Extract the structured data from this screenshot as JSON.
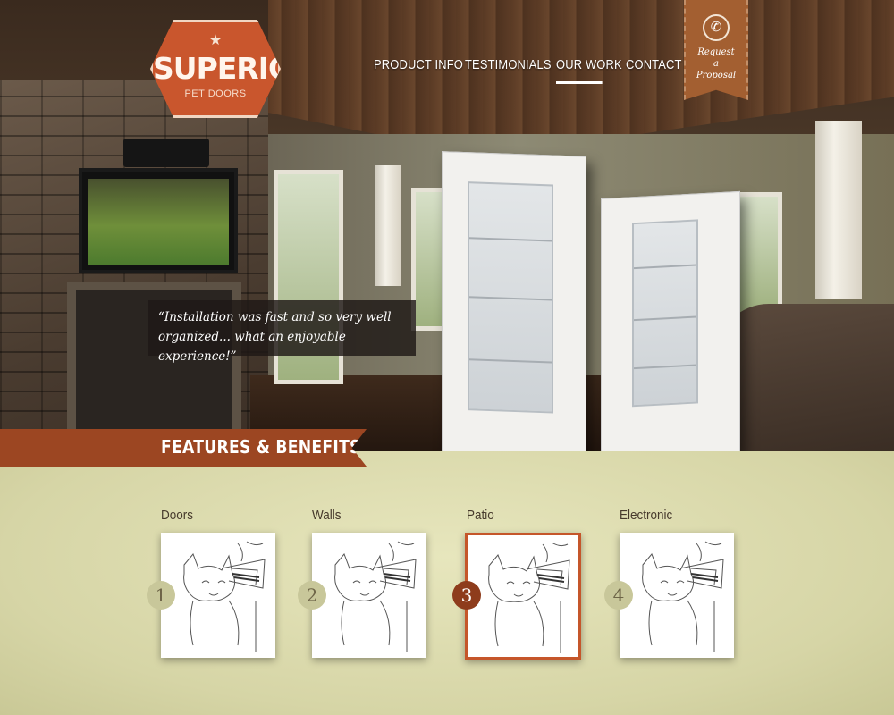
{
  "logo": {
    "brand": "SUPERIOR",
    "tagline": "PET DOORS"
  },
  "nav": [
    {
      "label": "PRODUCT INFO",
      "active": false
    },
    {
      "label": "TESTIMONIALS",
      "active": false
    },
    {
      "label": "OUR WORK",
      "active": true
    },
    {
      "label": "CONTACT",
      "active": false
    }
  ],
  "request": {
    "line1": "Request",
    "line2": "a",
    "line3": "Proposal"
  },
  "testimonial": {
    "line1": "“Installation was fast and so very well",
    "line2": "organized... what an enjoyable experience!”"
  },
  "features": {
    "heading": "FEATURES & BENEFITS"
  },
  "categories": [
    {
      "title": "Doors",
      "number": "1",
      "active": false
    },
    {
      "title": "Walls",
      "number": "2",
      "active": false
    },
    {
      "title": "Patio",
      "number": "3",
      "active": true
    },
    {
      "title": "Electronic",
      "number": "4",
      "active": false
    }
  ],
  "colors": {
    "accent": "#c9562d",
    "banner": "#a35f31",
    "ribbon": "#9c4622",
    "background": "#dcdcaa"
  },
  "icons": {
    "phone": "phone-icon",
    "logo_star": "star-icon"
  }
}
